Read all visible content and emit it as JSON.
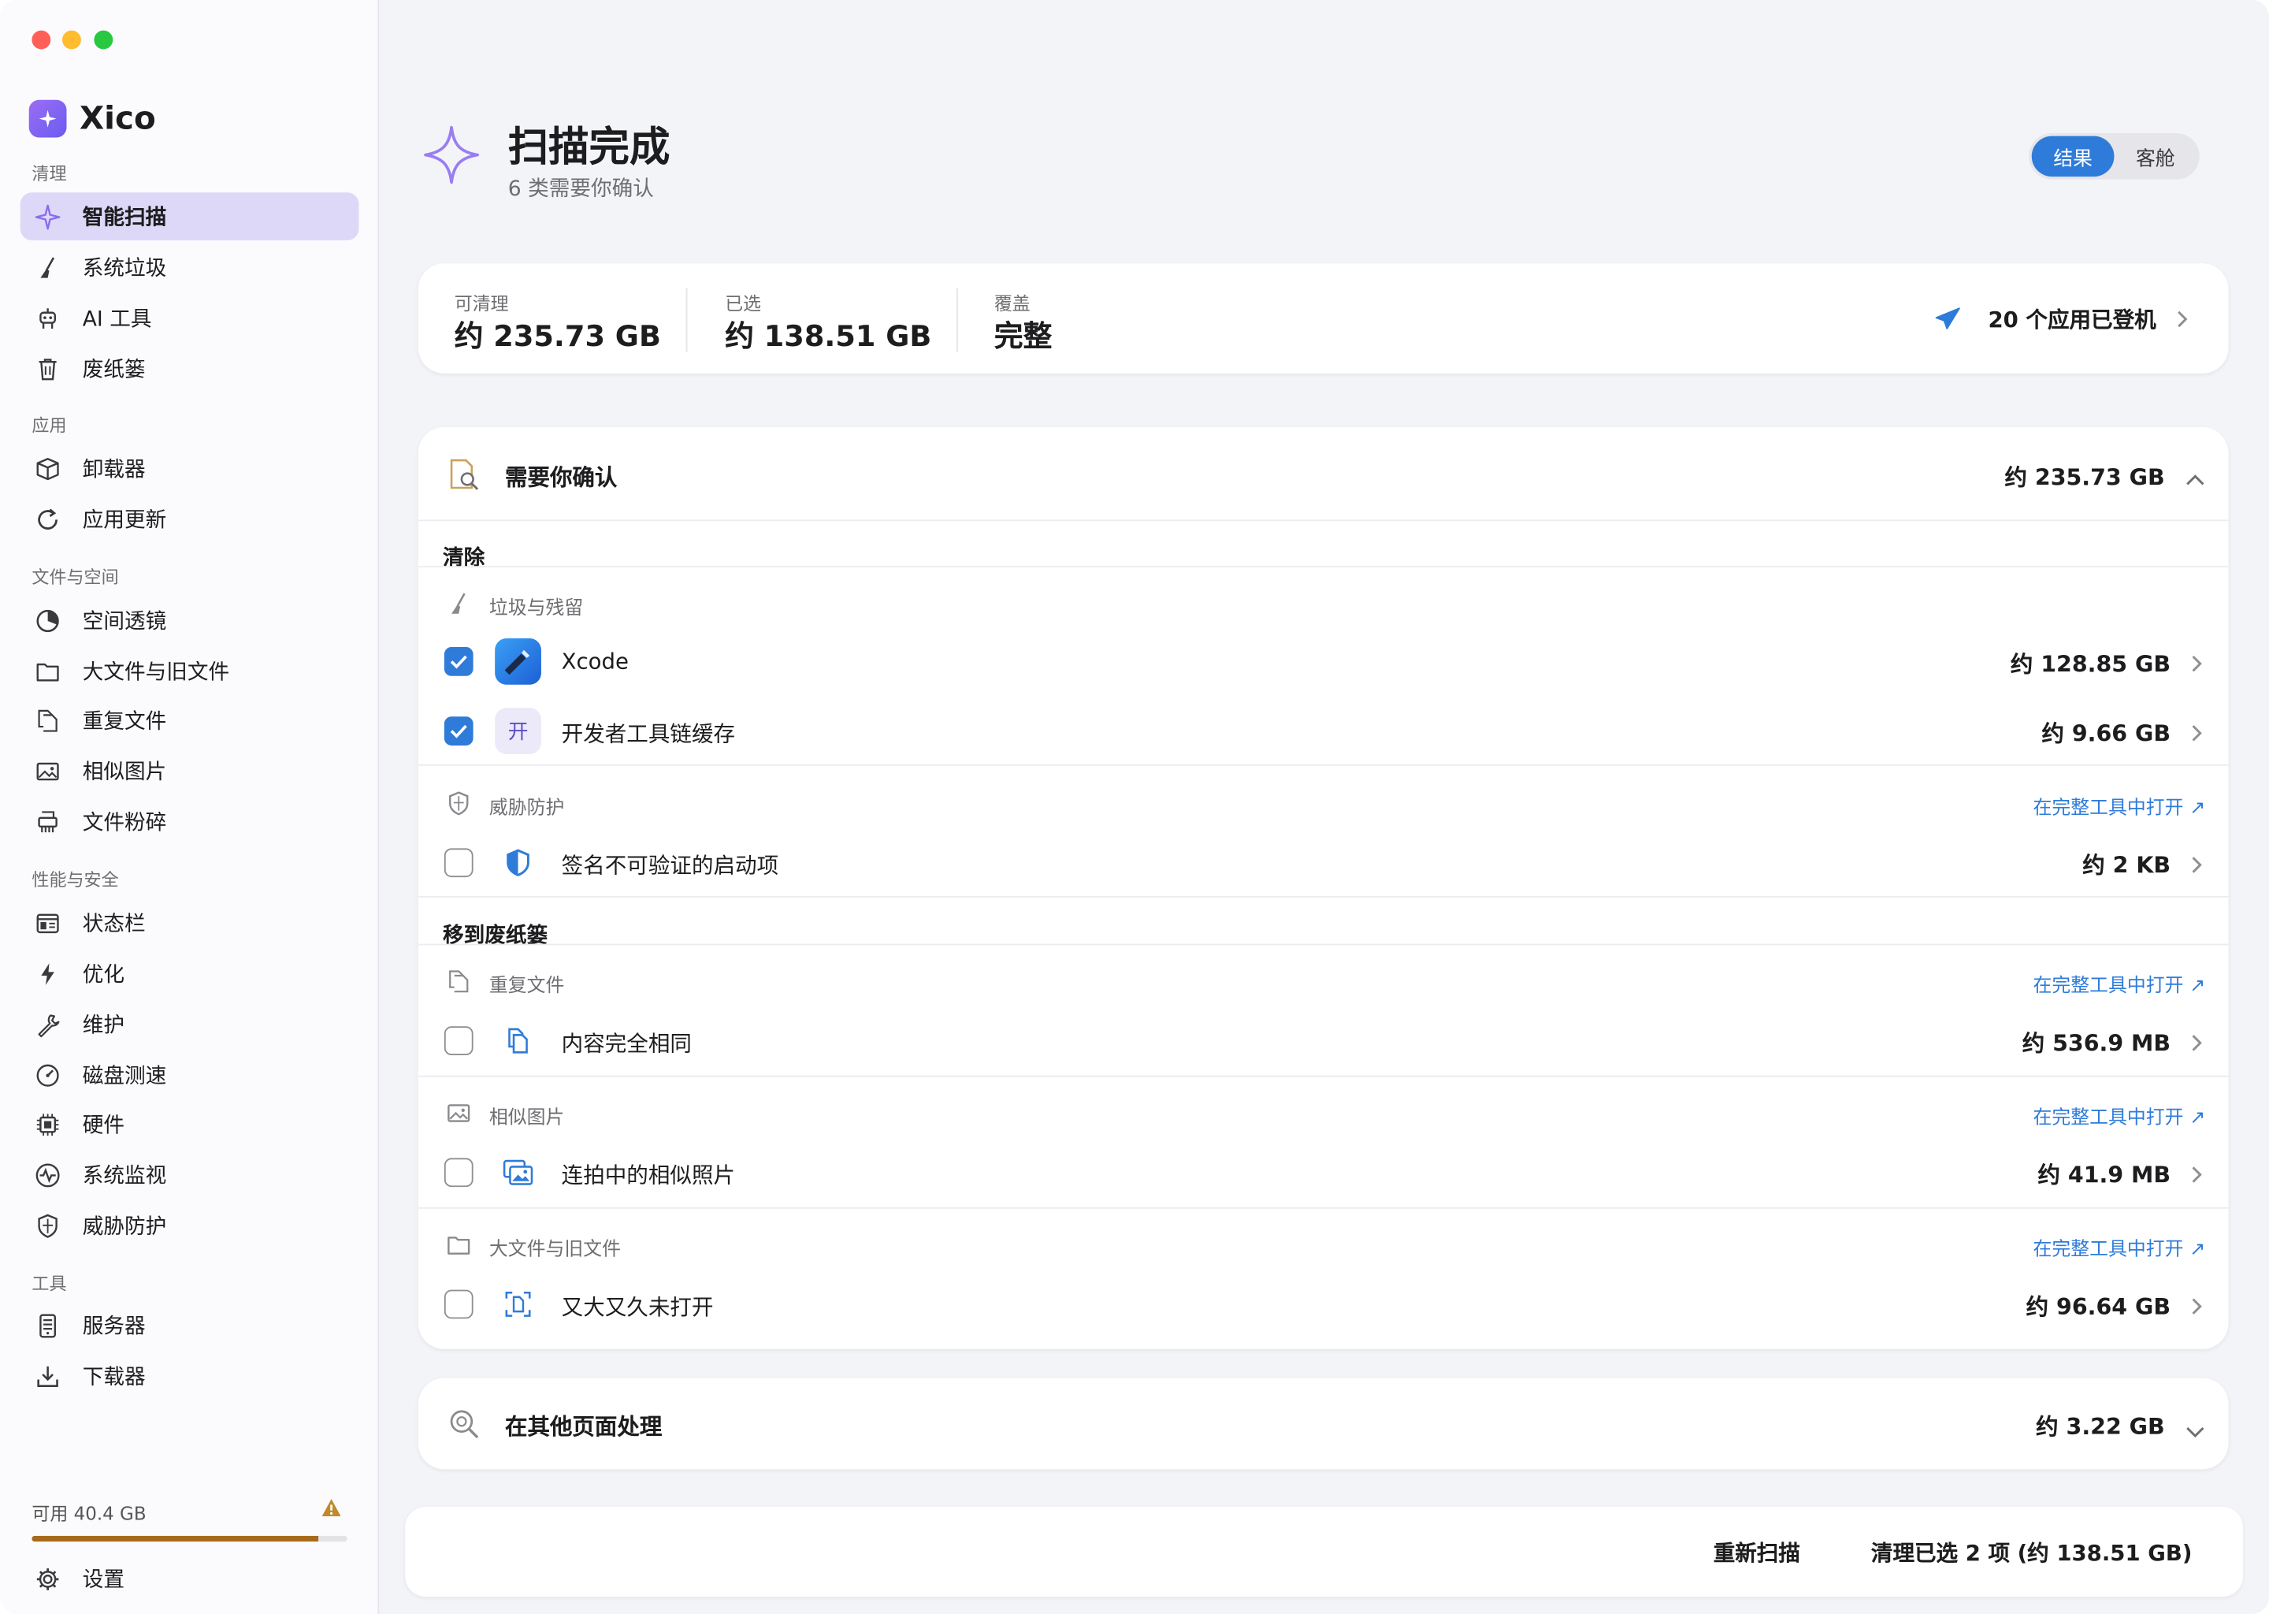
{
  "app": {
    "name": "Xico"
  },
  "sidebar": {
    "sections": [
      {
        "title": "清理",
        "items": [
          {
            "label": "智能扫描",
            "icon": "sparkle-icon",
            "active": true
          },
          {
            "label": "系统垃圾",
            "icon": "broom-icon"
          },
          {
            "label": "AI 工具",
            "icon": "robot-icon"
          },
          {
            "label": "废纸篓",
            "icon": "trash-icon"
          }
        ]
      },
      {
        "title": "应用",
        "items": [
          {
            "label": "卸载器",
            "icon": "box-icon"
          },
          {
            "label": "应用更新",
            "icon": "refresh-icon"
          }
        ]
      },
      {
        "title": "文件与空间",
        "items": [
          {
            "label": "空间透镜",
            "icon": "pie-icon"
          },
          {
            "label": "大文件与旧文件",
            "icon": "folder-icon"
          },
          {
            "label": "重复文件",
            "icon": "duplicate-icon"
          },
          {
            "label": "相似图片",
            "icon": "photo-icon"
          },
          {
            "label": "文件粉碎",
            "icon": "shredder-icon"
          }
        ]
      },
      {
        "title": "性能与安全",
        "items": [
          {
            "label": "状态栏",
            "icon": "menubar-icon"
          },
          {
            "label": "优化",
            "icon": "bolt-icon"
          },
          {
            "label": "维护",
            "icon": "wrench-icon"
          },
          {
            "label": "磁盘测速",
            "icon": "gauge-icon"
          },
          {
            "label": "硬件",
            "icon": "chip-icon"
          },
          {
            "label": "系统监视",
            "icon": "pulse-icon"
          },
          {
            "label": "威胁防护",
            "icon": "shield-icon"
          }
        ]
      },
      {
        "title": "工具",
        "items": [
          {
            "label": "服务器",
            "icon": "server-icon"
          },
          {
            "label": "下载器",
            "icon": "download-icon"
          }
        ]
      }
    ],
    "storage": {
      "label": "可用 40.4 GB",
      "used_fraction": 0.91
    },
    "settings_label": "设置"
  },
  "header": {
    "title": "扫描完成",
    "subtitle": "6 类需要你确认",
    "segment": {
      "active": "结果",
      "inactive": "客舱"
    }
  },
  "stats": {
    "cleanable": {
      "label": "可清理",
      "value": "约 235.73 GB"
    },
    "selected": {
      "label": "已选",
      "value": "约 138.51 GB"
    },
    "coverage": {
      "label": "覆盖",
      "value": "完整"
    },
    "landed": "20 个应用已登机"
  },
  "confirm": {
    "title": "需要你确认",
    "size": "约 235.73 GB",
    "groups": [
      {
        "title": "清除",
        "categories": [
          {
            "label": "垃圾与残留",
            "icon": "broom-icon",
            "items": [
              {
                "label": "Xcode",
                "size": "约 128.85 GB",
                "checked": true,
                "icon": "xcode-icon"
              },
              {
                "label": "开发者工具链缓存",
                "size": "约 9.66 GB",
                "checked": true,
                "icon": "kai-icon",
                "glyph": "开"
              }
            ]
          },
          {
            "label": "威胁防护",
            "icon": "shield-icon",
            "link": "在完整工具中打开",
            "items": [
              {
                "label": "签名不可验证的启动项",
                "size": "约 2 KB",
                "checked": false,
                "icon": "shield-half-icon"
              }
            ]
          }
        ]
      },
      {
        "title": "移到废纸篓",
        "categories": [
          {
            "label": "重复文件",
            "icon": "duplicate-icon",
            "link": "在完整工具中打开",
            "items": [
              {
                "label": "内容完全相同",
                "size": "约 536.9 MB",
                "checked": false,
                "icon": "docs-icon"
              }
            ]
          },
          {
            "label": "相似图片",
            "icon": "photo-icon",
            "link": "在完整工具中打开",
            "items": [
              {
                "label": "连拍中的相似照片",
                "size": "约 41.9 MB",
                "checked": false,
                "icon": "photos-icon"
              }
            ]
          },
          {
            "label": "大文件与旧文件",
            "icon": "folder-icon",
            "link": "在完整工具中打开",
            "items": [
              {
                "label": "又大又久未打开",
                "size": "约 96.64 GB",
                "checked": false,
                "icon": "doc-scan-icon"
              }
            ]
          }
        ]
      }
    ]
  },
  "other": {
    "title": "在其他页面处理",
    "size": "约 3.22 GB"
  },
  "footer": {
    "rescan": "重新扫描",
    "clean": "清理已选 2 项 (约 138.51 GB)"
  },
  "colors": {
    "accent": "#2f7bd9",
    "active_nav": "#ddd8f7",
    "brand": "#7b61f2",
    "storage_bar": "#a66a1a"
  }
}
